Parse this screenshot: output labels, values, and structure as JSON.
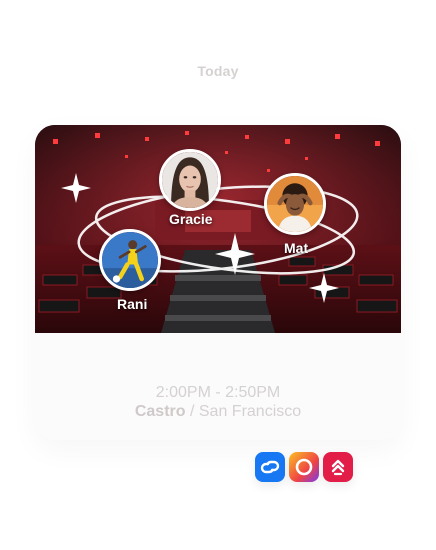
{
  "header": {
    "day_label": "Today"
  },
  "event": {
    "attendees": [
      {
        "name": "Gracie",
        "avatar_icon": "woman-portrait"
      },
      {
        "name": "Mat",
        "avatar_icon": "man-with-hands-on-head"
      },
      {
        "name": "Rani",
        "avatar_icon": "soccer-player"
      }
    ],
    "time": "2:00PM - 2:50PM",
    "venue": "Castro",
    "separator": " / ",
    "city": "San Francisco"
  },
  "apps": [
    {
      "name": "link-app-icon",
      "color": "#1877f2"
    },
    {
      "name": "ring-app-icon",
      "color": "#f97316"
    },
    {
      "name": "double-chevron-app-icon",
      "color": "#e11d48"
    }
  ],
  "colors": {
    "muted_text": "#d6d1d1",
    "card_bg": "#fbfbfb",
    "room_red": "#b3121f"
  }
}
